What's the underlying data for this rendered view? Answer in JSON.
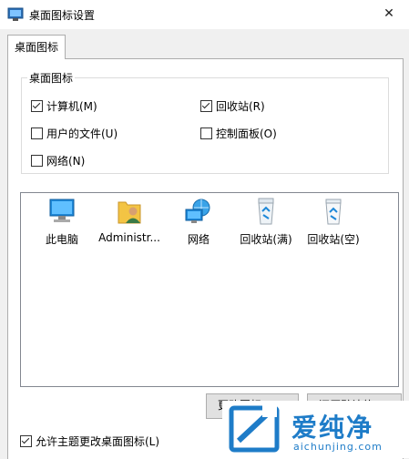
{
  "window": {
    "title": "桌面图标设置",
    "close_glyph": "✕"
  },
  "tabs": [
    {
      "label": "桌面图标",
      "active": true
    }
  ],
  "group": {
    "legend": "桌面图标",
    "checkboxes": [
      {
        "label": "计算机(M)",
        "checked": true
      },
      {
        "label": "回收站(R)",
        "checked": true
      },
      {
        "label": "用户的文件(U)",
        "checked": false
      },
      {
        "label": "控制面板(O)",
        "checked": false
      },
      {
        "label": "网络(N)",
        "checked": false
      }
    ]
  },
  "icons": [
    {
      "label": "此电脑",
      "icon": "monitor-icon"
    },
    {
      "label": "Administr...",
      "icon": "user-folder-icon"
    },
    {
      "label": "网络",
      "icon": "network-icon"
    },
    {
      "label": "回收站(满)",
      "icon": "recycle-bin-full-icon"
    },
    {
      "label": "回收站(空)",
      "icon": "recycle-bin-empty-icon"
    }
  ],
  "buttons": {
    "change_icon": "更改图标...",
    "restore_default": "还原默认值"
  },
  "footer": {
    "allow_themes_label": "允许主题更改桌面图标(L)",
    "allow_themes_checked": true
  },
  "watermark": {
    "brand": "爱纯净",
    "url": "aichunjing.com"
  },
  "colors": {
    "accent": "#1e7cc8",
    "window_bg": "#f0f0f0"
  }
}
